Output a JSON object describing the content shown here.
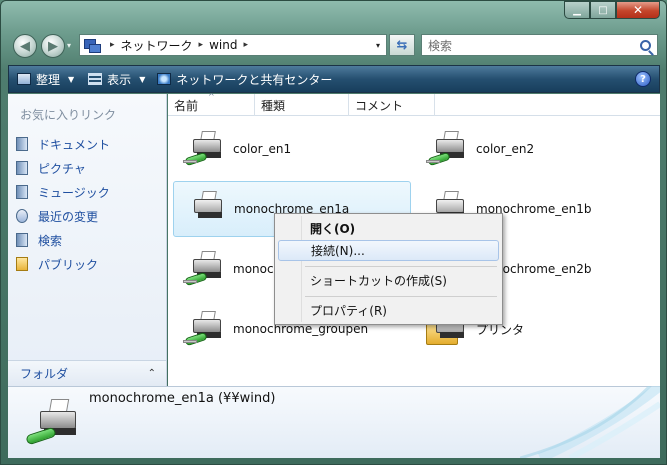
{
  "window": {
    "caption_buttons": {
      "minimize": "▁",
      "maximize": "□",
      "close": "✕"
    }
  },
  "nav": {
    "back_glyph": "◀",
    "forward_glyph": "▶",
    "address_segments": [
      "ネットワーク",
      "wind"
    ],
    "address_separator": "▸",
    "address_dropdown": "▾",
    "refresh_glyph": "⇆",
    "search_placeholder": "検索"
  },
  "toolbar": {
    "organize": "整理",
    "view": "表示",
    "network_center": "ネットワークと共有センター",
    "help": "?"
  },
  "sidebar": {
    "title": "お気に入りリンク",
    "items": [
      {
        "label": "ドキュメント",
        "icon": "documents-icon"
      },
      {
        "label": "ピクチャ",
        "icon": "pictures-icon"
      },
      {
        "label": "ミュージック",
        "icon": "music-icon"
      },
      {
        "label": "最近の変更",
        "icon": "recent-icon"
      },
      {
        "label": "検索",
        "icon": "search-folder-icon"
      },
      {
        "label": "パブリック",
        "icon": "public-folder-icon"
      }
    ],
    "folder_bar": "フォルダ",
    "folder_chevron": "⌃"
  },
  "columns": [
    "名前",
    "種類",
    "コメント"
  ],
  "items": [
    {
      "label": "color_en1"
    },
    {
      "label": "color_en2"
    },
    {
      "label": "monochrome_en1a"
    },
    {
      "label": "monochrome_en1b"
    },
    {
      "label": "monochrome_en2a"
    },
    {
      "label": "monochrome_en2b"
    },
    {
      "label": "monochrome_groupen"
    },
    {
      "label": "プリンタ"
    }
  ],
  "context_menu": [
    "開く(O)",
    "接続(N)...",
    "ショートカットの作成(S)",
    "プロパティ(R)"
  ],
  "details": {
    "name": "monochrome_en1a (¥¥wind)"
  },
  "colors": {
    "accent": "#1f4fa0",
    "selection": "#d8eefb"
  }
}
